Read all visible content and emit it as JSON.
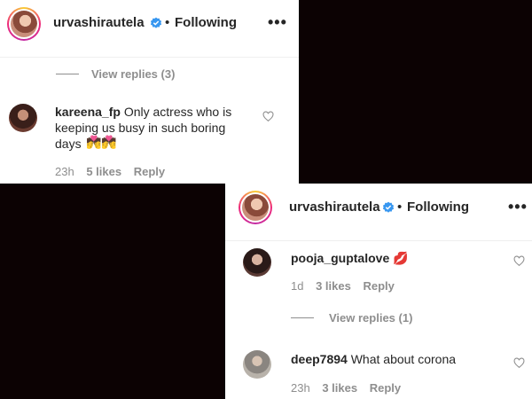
{
  "panel1": {
    "header": {
      "username": "urvashirautela",
      "separator": "•",
      "following": "Following",
      "more": "•••"
    },
    "view_replies": "View replies (3)",
    "comment": {
      "username": "kareena_fp",
      "text_line1": "Only actress who is",
      "text_line2": "keeping us busy in such boring",
      "text_line3": "days",
      "emoji": "💏💏",
      "time": "23h",
      "likes": "5 likes",
      "reply": "Reply"
    }
  },
  "panel2": {
    "header": {
      "username": "urvashirautela",
      "separator": "•",
      "following": "Following",
      "more": "•••"
    },
    "comments": [
      {
        "username": "pooja_guptalove",
        "text": "",
        "emoji": "💋",
        "time": "1d",
        "likes": "3 likes",
        "reply": "Reply"
      },
      {
        "username": "deep7894",
        "text": "What about corona",
        "time": "23h",
        "likes": "3 likes",
        "reply": "Reply"
      }
    ],
    "view_replies": "View replies (1)"
  },
  "colors": {
    "background": "#0c0203",
    "verified": "#3897f0",
    "muted": "#8e8e8e",
    "text": "#262626"
  }
}
